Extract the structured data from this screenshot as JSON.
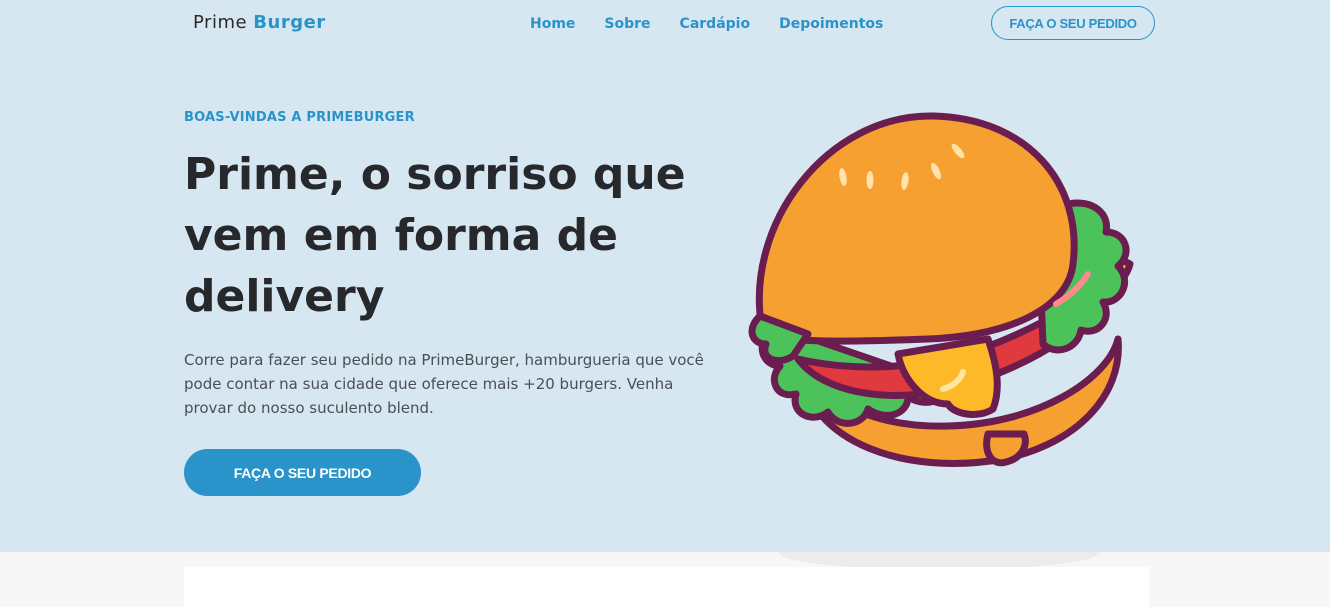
{
  "header": {
    "brand_first": "Prime",
    "brand_second": "Burger",
    "nav": [
      "Home",
      "Sobre",
      "Cardápio",
      "Depoimentos"
    ],
    "cta_label": "FAÇA O SEU PEDIDO"
  },
  "hero": {
    "eyebrow": "BOAS-VINDAS A PRIMEBURGER",
    "title": "Prime, o sorriso que vem em forma de delivery",
    "description": "Corre para fazer seu pedido na PrimeBurger, hamburgueria que você pode contar na sua cidade que oferece mais +20 burgers. Venha provar do nosso suculento blend.",
    "cta_label": "FAÇA O SEU PEDIDO",
    "image_icon": "burger-illustration"
  },
  "colors": {
    "accent": "#2a93c9",
    "hero_bg": "#d6e7f1",
    "text_dark": "#26282b",
    "outline": "#6b1d4f",
    "bun": "#f5a030",
    "lettuce": "#4cc25a",
    "tomato": "#e03a3e",
    "cheese": "#fdb927"
  }
}
